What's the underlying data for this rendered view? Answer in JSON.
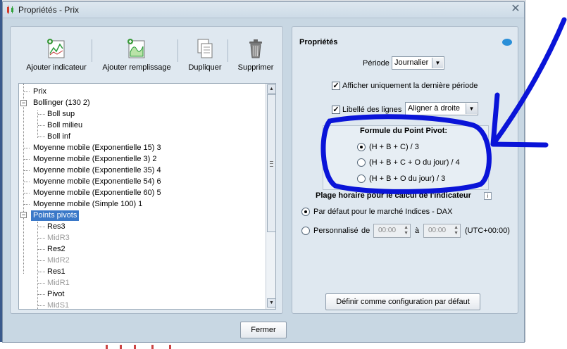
{
  "window": {
    "title": "Propriétés - Prix",
    "close_label": "✕"
  },
  "toolbar": {
    "buttons": [
      {
        "label": "Ajouter indicateur",
        "icon": "add-indicator-icon"
      },
      {
        "label": "Ajouter remplissage",
        "icon": "add-fill-icon"
      },
      {
        "label": "Dupliquer",
        "icon": "duplicate-icon"
      },
      {
        "label": "Supprimer",
        "icon": "trash-icon"
      }
    ]
  },
  "tree": {
    "items": [
      {
        "label": "Prix"
      },
      {
        "label": "Bollinger (130 2)",
        "expander": "−"
      },
      {
        "label": "Boll sup"
      },
      {
        "label": "Boll milieu"
      },
      {
        "label": "Boll inf"
      },
      {
        "label": "Moyenne mobile (Exponentielle 15) 3"
      },
      {
        "label": "Moyenne mobile (Exponentielle 3) 2"
      },
      {
        "label": "Moyenne mobile (Exponentielle 35) 4"
      },
      {
        "label": "Moyenne mobile (Exponentielle 54) 6"
      },
      {
        "label": "Moyenne mobile (Exponentielle 60) 5"
      },
      {
        "label": "Moyenne mobile (Simple 100) 1"
      },
      {
        "label": "Points pivots",
        "expander": "−",
        "selected": true
      },
      {
        "label": "Res3"
      },
      {
        "label": "MidR3",
        "disabled": true
      },
      {
        "label": "Res2"
      },
      {
        "label": "MidR2",
        "disabled": true
      },
      {
        "label": "Res1"
      },
      {
        "label": "MidR1",
        "disabled": true
      },
      {
        "label": "Pivot"
      },
      {
        "label": "MidS1",
        "disabled": true
      }
    ]
  },
  "properties": {
    "heading": "Propriétés",
    "periode_label": "Période",
    "periode_value": "Journalier",
    "last_period_label": "Afficher uniquement la dernière période",
    "last_period_checked": true,
    "line_label_label": "Libellé des lignes",
    "line_label_checked": true,
    "line_label_value": "Aligner à droite",
    "pivot_heading": "Formule du Point Pivot:",
    "pivot_options": [
      {
        "label": "(H + B + C) / 3",
        "checked": true
      },
      {
        "label": "(H + B + C + O du jour) / 4",
        "checked": false
      },
      {
        "label": "(H + B + O du jour) / 3",
        "checked": false
      }
    ],
    "range_heading": "Plage horaire pour le calcul de l'indicateur",
    "default_market_label": "Par défaut pour le marché Indices - DAX",
    "custom_label": "Personnalisé",
    "from_label": "de",
    "from_value": "00:00",
    "to_label": "à",
    "to_value": "00:00",
    "timezone": "(UTC+00:00)",
    "set_default_button": "Définir comme configuration par défaut"
  },
  "footer": {
    "close_button": "Fermer"
  },
  "colors": {
    "annotation_stroke": "#0a14d8",
    "selection": "#3a78c8"
  }
}
